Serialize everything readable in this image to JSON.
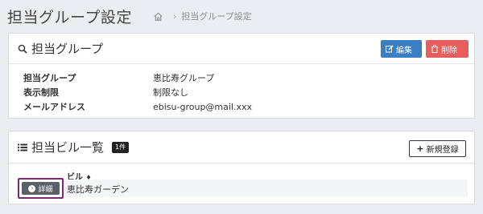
{
  "header": {
    "title": "担当グループ設定",
    "breadcrumb_sep": "›",
    "breadcrumb_current": "担当グループ設定"
  },
  "group_card": {
    "title": "担当グループ",
    "edit_label": "編集",
    "delete_label": "削除",
    "fields": [
      {
        "label": "担当グループ",
        "value": "恵比寿グループ"
      },
      {
        "label": "表示制限",
        "value": "制限なし"
      },
      {
        "label": "メールアドレス",
        "value": "ebisu-group@mail.xxx"
      }
    ]
  },
  "building_card": {
    "title": "担当ビル一覧",
    "count_badge": "1件",
    "new_label": "新規登録",
    "column_header": "ビル",
    "sort_indicator": "♦",
    "rows": [
      {
        "detail_label": "詳細",
        "name": "恵比寿ガーデン"
      }
    ]
  },
  "colors": {
    "edit_button": "#3a7fc4",
    "delete_button": "#e65e5e",
    "detail_button": "#5b6168",
    "highlight_border": "#7b2a6f"
  },
  "icons": {
    "home": "home-icon",
    "search": "search-icon",
    "edit": "edit-icon",
    "trash": "trash-icon",
    "list": "list-icon",
    "plus": "plus-icon",
    "arrow": "arrow-right-circle-icon"
  }
}
